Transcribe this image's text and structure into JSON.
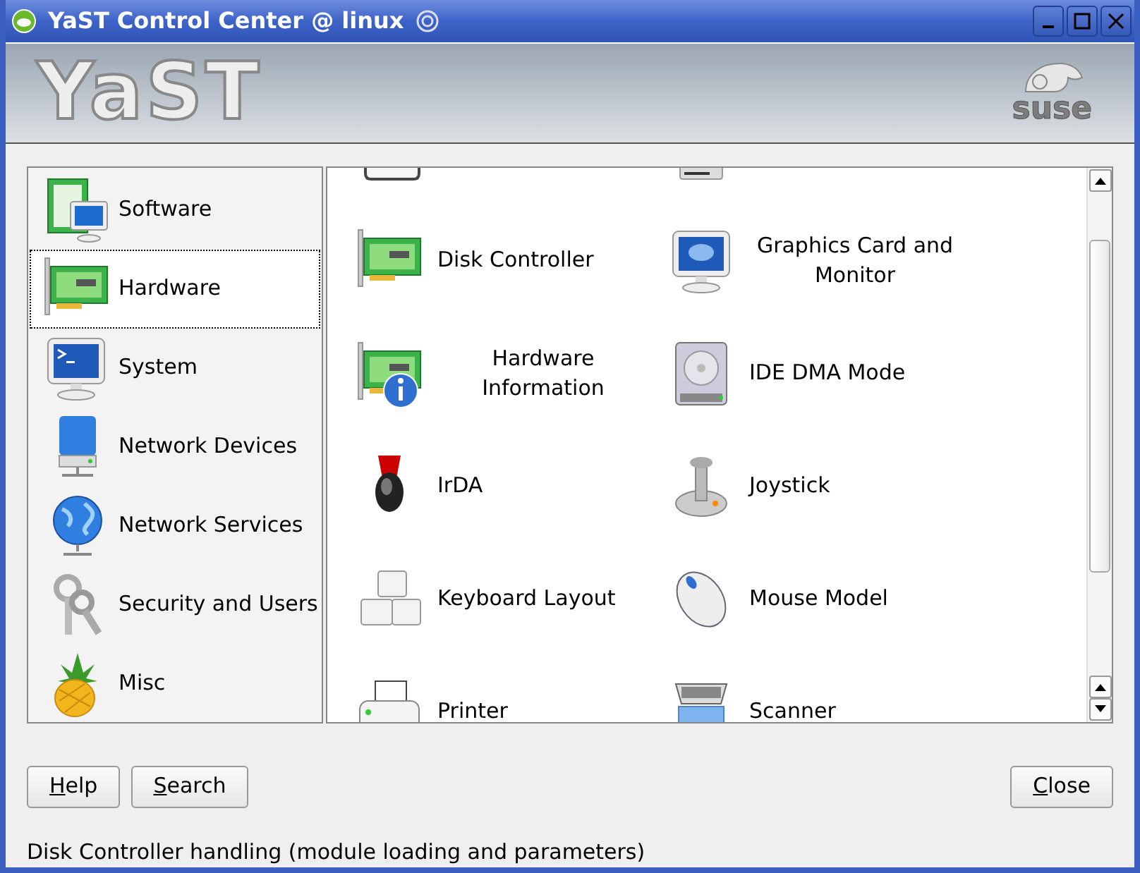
{
  "window": {
    "title": "YaST Control Center @ linux"
  },
  "banner": {
    "logo": "YaST",
    "brand": "suse"
  },
  "sidebar": {
    "items": [
      {
        "label": "Software",
        "selected": false
      },
      {
        "label": "Hardware",
        "selected": true
      },
      {
        "label": "System",
        "selected": false
      },
      {
        "label": "Network Devices",
        "selected": false
      },
      {
        "label": "Network Services",
        "selected": false
      },
      {
        "label": "Security and Users",
        "selected": false
      },
      {
        "label": "Misc",
        "selected": false
      }
    ]
  },
  "modules": [
    {
      "label": "Disk Controller"
    },
    {
      "label": "Graphics Card and Monitor"
    },
    {
      "label": "Hardware Information"
    },
    {
      "label": "IDE DMA Mode"
    },
    {
      "label": "IrDA"
    },
    {
      "label": "Joystick"
    },
    {
      "label": "Keyboard Layout"
    },
    {
      "label": "Mouse Model"
    },
    {
      "label": "Printer"
    },
    {
      "label": "Scanner"
    }
  ],
  "buttons": [
    {
      "label": "Help"
    },
    {
      "label": "Search"
    }
  ],
  "close_button": {
    "label": "Close"
  },
  "status_bar": "Disk Controller handling (module loading and parameters)"
}
